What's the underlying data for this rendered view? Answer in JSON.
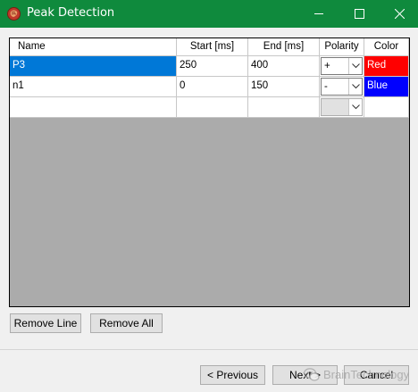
{
  "window": {
    "title": "Peak Detection",
    "app_icon": "brain-app-icon",
    "controls": [
      "minimize-icon",
      "maximize-icon",
      "close-icon"
    ],
    "titlebar_color": "#0f8a3d"
  },
  "grid": {
    "columns": [
      "Name",
      "Start [ms]",
      "End [ms]",
      "Polarity",
      "Color"
    ],
    "rows": [
      {
        "name": "P3",
        "start": "250",
        "end": "400",
        "polarity": "+",
        "color": "Red",
        "color_hex": "#ff0000",
        "selected": true
      },
      {
        "name": "n1",
        "start": "0",
        "end": "150",
        "polarity": "-",
        "color": "Blue",
        "color_hex": "#0000ff",
        "selected": false
      },
      {
        "name": "",
        "start": "",
        "end": "",
        "polarity": "",
        "color": "",
        "color_hex": "#ffffff",
        "selected": false
      }
    ],
    "selection_color": "#0078d7"
  },
  "buttons": {
    "remove_line": "Remove Line",
    "remove_all": "Remove All",
    "previous": "< Previous",
    "next": "Next >",
    "cancel": "Cancel"
  },
  "watermark": {
    "text": "BrainTechnology",
    "icon": "wechat-icon"
  }
}
